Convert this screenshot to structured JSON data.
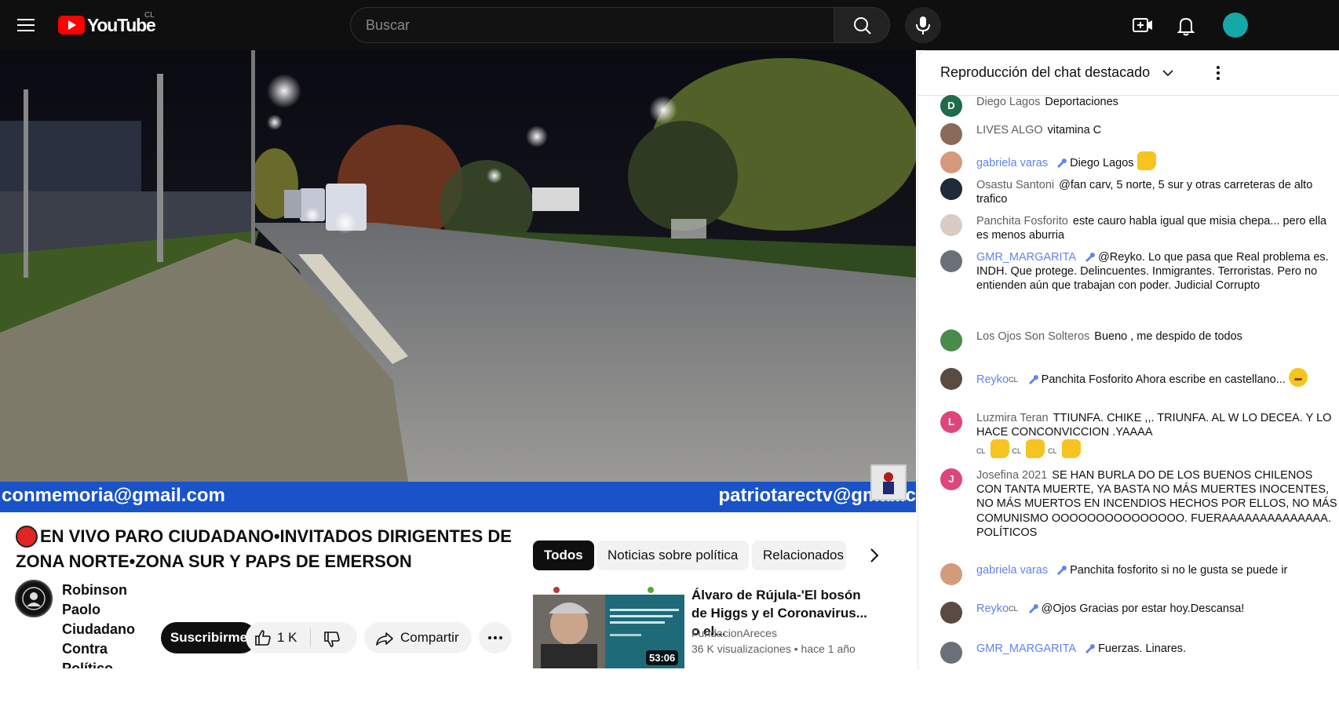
{
  "header": {
    "logo_text": "YouTube",
    "country_code": "CL",
    "search_placeholder": "Buscar"
  },
  "video": {
    "banner_left": "conmemoria@gmail.com",
    "banner_right": "patriotarectv@gmail.c"
  },
  "meta": {
    "title": "EN VIVO PARO CIUDADANO•INVITADOS DIRIGENTES DE ZONA NORTE•ZONA SUR Y PAPS DE EMERSON",
    "channel_name": "Robinson Paolo Ciudadano Contra Político",
    "subscribe_label": "Suscribirme",
    "like_count": "1 K",
    "share_label": "Compartir"
  },
  "chips": [
    {
      "label": "Todos"
    },
    {
      "label": "Noticias sobre política"
    },
    {
      "label": "Relacionados"
    }
  ],
  "recommended": {
    "title": "Álvaro de Rújula-'El bosón de Higgs y el Coronavirus... o el...",
    "channel": "FundacionAreces",
    "views": "36 K visualizaciones",
    "age": "hace 1 año",
    "duration": "53:06"
  },
  "chat": {
    "title": "Reproducción del chat destacado",
    "messages": [
      {
        "author": "Diego Lagos",
        "text": "Deportaciones",
        "initial": "D"
      },
      {
        "author": "LIVES ALGO",
        "text": "vitamina C"
      },
      {
        "author": "gabriela varas",
        "text": "Diego Lagos"
      },
      {
        "author": "Osastu Santoni",
        "text": "@fan carv, 5 norte, 5 sur y otras carreteras de alto trafico"
      },
      {
        "author": "Panchita Fosforito",
        "text": "este cauro habla igual que misia chepa... pero ella es menos aburria"
      },
      {
        "author": "GMR_MARGARITA",
        "text": "@Reyko. Lo que pasa que Real problema es. INDH. Que protege. Delincuentes. Inmigrantes. Terroristas. Pero no entienden aún que trabajan con poder. Judicial Corrupto"
      },
      {
        "author": "Los Ojos Son Solteros",
        "text": "Bueno , me despido de todos"
      },
      {
        "author": "Reyko",
        "flag": "CL",
        "text": "Panchita Fosforito Ahora escribe en castellano..."
      },
      {
        "author": "Luzmira Teran",
        "text": "TTIUNFA. CHIKE ,,. TRIUNFA. AL W LO DECEA. Y LO HACE CONCONVICCION .YAAAA",
        "initial": "L",
        "flag": "CL"
      },
      {
        "author": "Josefina 2021",
        "text": "SE HAN BURLA DO DE LOS BUENOS CHILENOS CON TANTA MUERTE, YA BASTA NO MÁS MUERTES INOCENTES, NO MÁS MUERTOS EN INCENDIOS HECHOS POR ELLOS, NO MÁS COMUNISMO OOOOOOOOOOOOOOO. FUERAAAAAAAAAAAAAA. POLÍTICOS",
        "initial": "J"
      },
      {
        "author": "gabriela varas",
        "text": "Panchita fosforito si no le gusta se puede ir"
      },
      {
        "author": "Reyko",
        "flag": "CL",
        "text": "@Ojos Gracias por estar hoy.Descansa!"
      },
      {
        "author": "GMR_MARGARITA",
        "text": "Fuerzas. Linares."
      }
    ]
  },
  "colors": {
    "brand_red": "#ff0000",
    "moderator_blue": "#5e84f1",
    "banner_blue": "#1a53c9"
  }
}
